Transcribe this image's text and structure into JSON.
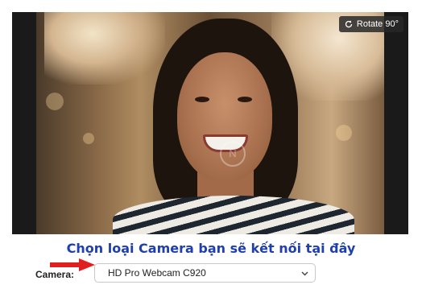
{
  "preview": {
    "rotate_label": "Rotate 90°",
    "rotate_icon": "rotate-icon",
    "watermark_icon": "watermark-logo"
  },
  "caption": {
    "text": "Chọn loại Camera bạn sẽ kết nối tại đây",
    "color": "#1f3fae"
  },
  "camera": {
    "label": "Camera:",
    "selected": "HD Pro Webcam C920",
    "arrow_color": "#e02020"
  }
}
